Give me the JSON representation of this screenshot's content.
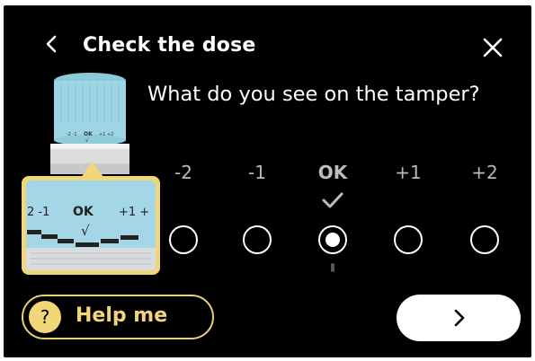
{
  "header": {
    "title": "Check the dose",
    "back_icon": "chevron-left-icon",
    "close_icon": "close-icon"
  },
  "question": "What do you see on the tamper?",
  "tamper_image": {
    "scale_labels": [
      "-2",
      "-1",
      "OK",
      "+1",
      "+2"
    ]
  },
  "options": [
    {
      "label": "-2",
      "selected": false
    },
    {
      "label": "-1",
      "selected": false
    },
    {
      "label": "OK",
      "selected": true
    },
    {
      "label": "+1",
      "selected": false
    },
    {
      "label": "+2",
      "selected": false
    }
  ],
  "help_button": {
    "icon": "?",
    "label": "Help me"
  },
  "next_button": {
    "icon": "chevron-right-icon"
  },
  "colors": {
    "background": "#000000",
    "accent": "#f1d77a",
    "tamper_blue": "#9ed4e3"
  }
}
